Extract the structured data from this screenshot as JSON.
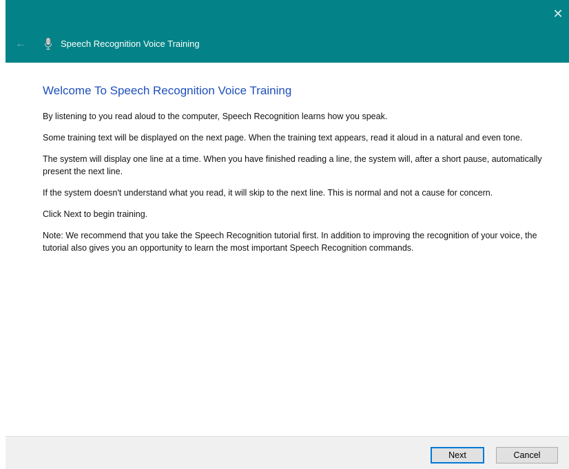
{
  "window": {
    "title": "Speech Recognition Voice Training",
    "close_glyph": "✕",
    "back_glyph": "←",
    "icons": {
      "close": "close-icon",
      "back": "back-arrow-icon",
      "app": "microphone-icon"
    },
    "colors": {
      "titlebar": "#038387",
      "heading": "#1e4fbd",
      "accent_button_border": "#0078d7"
    }
  },
  "main": {
    "heading": "Welcome To Speech Recognition Voice Training",
    "paragraphs": [
      "By listening to you read aloud to the computer, Speech Recognition learns how you speak.",
      "Some training text will be displayed on the next page. When the training text appears, read it aloud in a natural and even tone.",
      "The system will display one line at a time. When you have finished reading a line, the system will, after a short pause, automatically present the next line.",
      "If the system doesn't understand what you read, it will skip to the next line. This is normal and not a cause for concern.",
      "Click Next to begin training.",
      "Note: We recommend that you take the Speech Recognition tutorial first. In addition to improving the recognition of your voice, the tutorial also gives you an opportunity to learn the most important Speech Recognition commands."
    ]
  },
  "footer": {
    "next_label": "Next",
    "cancel_label": "Cancel"
  }
}
